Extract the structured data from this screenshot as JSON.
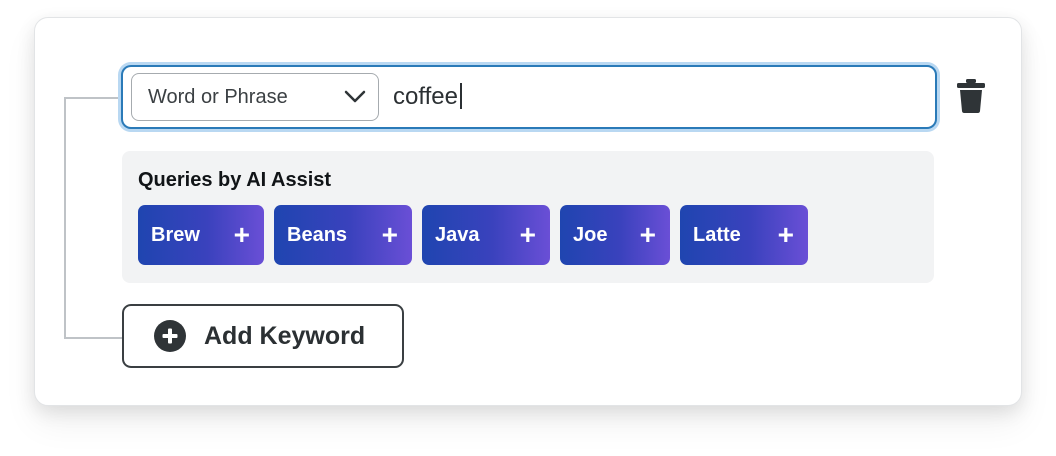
{
  "keyword": {
    "match_type": "Word or Phrase",
    "value": "coffee"
  },
  "ai_assist": {
    "title": "Queries by AI Assist",
    "suggestions": [
      "Brew",
      "Beans",
      "Java",
      "Joe",
      "Latte"
    ],
    "add_symbol": "+"
  },
  "add_keyword": {
    "label": "Add Keyword"
  },
  "icons": {
    "dropdown": "chevron-down-icon",
    "delete": "trash-icon",
    "add": "plus-circle-icon"
  },
  "colors": {
    "focus_border": "#2a7ab8",
    "chip_gradient_start": "#1f45b0",
    "chip_gradient_end": "#6a4fd6",
    "panel_bg": "#f2f3f4"
  }
}
